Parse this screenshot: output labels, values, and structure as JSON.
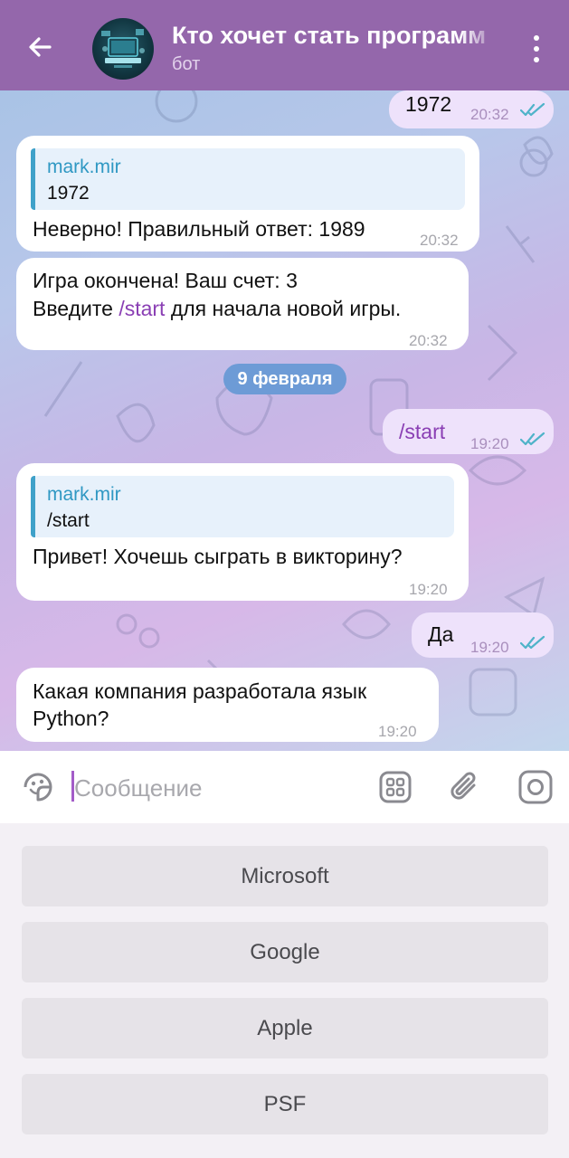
{
  "header": {
    "title": "Кто хочет стать программ",
    "subtitle": "бот"
  },
  "messages": {
    "m1": {
      "text": "1972",
      "time": "20:32"
    },
    "m2": {
      "reply_name": "mark.mir",
      "reply_text": "1972",
      "text": "Неверно! Правильный ответ: 1989",
      "time": "20:32"
    },
    "m3": {
      "line1": "Игра окончена! Ваш счет: 3",
      "line2_pre": "Введите ",
      "line2_cmd": "/start",
      "line2_post": " для начала новой игры.",
      "time": "20:32"
    },
    "date": "9 февраля",
    "m4": {
      "text": "/start",
      "time": "19:20"
    },
    "m5": {
      "reply_name": "mark.mir",
      "reply_text": "/start",
      "text": "Привет! Хочешь сыграть в викторину?",
      "time": "19:20"
    },
    "m6": {
      "text": "Да",
      "time": "19:20"
    },
    "m7": {
      "line1": "Какая компания разработала язык",
      "line2": "Python?",
      "time": "19:20"
    }
  },
  "input": {
    "placeholder": "Сообщение"
  },
  "keyboard": {
    "buttons": [
      "Microsoft",
      "Google",
      "Apple",
      "PSF"
    ]
  },
  "colors": {
    "header": "#9467ab",
    "outgoing_bubble": "#eee2fb",
    "incoming_bubble": "#ffffff",
    "check_marks": "#4fb3c9",
    "date_pill": "#6d9bd6"
  },
  "icons": {
    "back": "arrow-left-icon",
    "menu": "more-vertical-icon",
    "sticker": "sticker-icon",
    "bot_commands": "grid-icon",
    "attach": "paperclip-icon",
    "camera": "camera-icon"
  }
}
